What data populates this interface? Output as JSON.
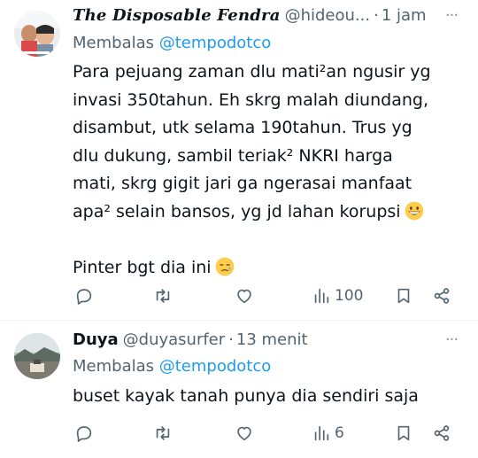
{
  "tweets": [
    {
      "author_name": "The Disposable Fendra",
      "handle": "@hideou...",
      "time": "1 jam",
      "reply_label": "Membalas",
      "reply_to": "@tempodotco",
      "lines": [
        "Para pejuang zaman dlu mati²an ngusir yg",
        "invasi 350tahun. Eh skrg malah diundang,",
        "disambut, utk selama 190tahun. Trus yg",
        "dlu dukung, sambil teriak² NKRI harga",
        "mati, skrg gigit jari ga ngerasai manfaat",
        "apa² selain bansos, yg jd lahan korupsi",
        "",
        "Pinter bgt dia ini"
      ],
      "emoji_grin": "grinning-face-emoji",
      "emoji_sad": "sad-relieved-face-emoji",
      "views": "100"
    },
    {
      "author_name": "Duya",
      "handle": "@duyasurfer",
      "time": "13 menit",
      "reply_label": "Membalas",
      "reply_to": "@tempodotco",
      "lines": [
        "buset kayak tanah punya dia sendiri saja"
      ],
      "views": "6"
    }
  ],
  "colors": {
    "text": "#0f1419",
    "secondary": "#536471",
    "link": "#1d9bf0",
    "divider": "#eff3f4"
  },
  "icons": [
    "reply-icon",
    "retweet-icon",
    "like-icon",
    "views-icon",
    "bookmark-icon",
    "share-icon",
    "more-icon"
  ]
}
